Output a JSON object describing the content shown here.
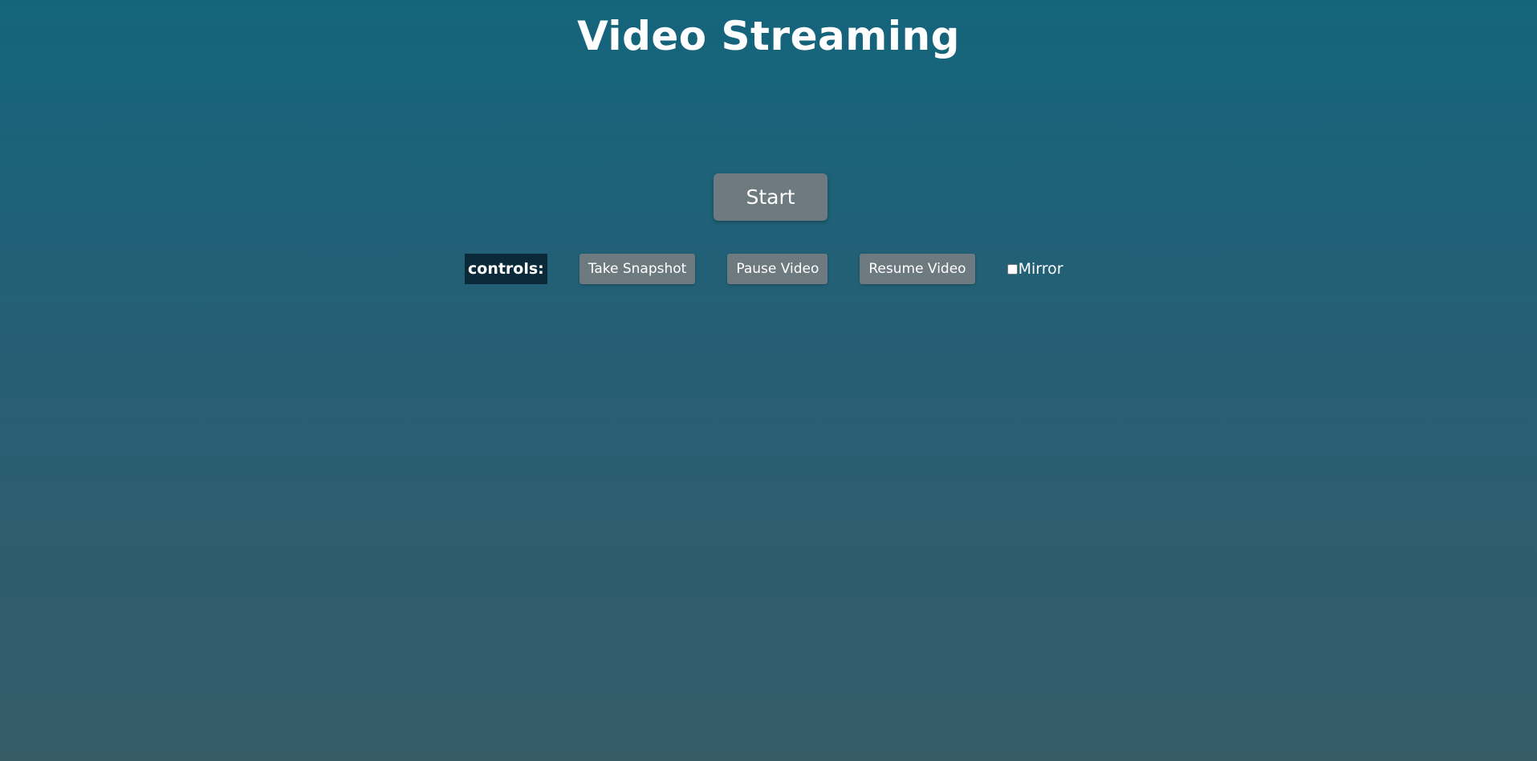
{
  "page": {
    "title": "Video Streaming"
  },
  "start_button": {
    "label": "Start"
  },
  "controls": {
    "label": "controls:",
    "snapshot_label": "Take Snapshot",
    "pause_label": "Pause Video",
    "resume_label": "Resume Video",
    "mirror_label": "Mirror",
    "mirror_checked": false
  },
  "colors": {
    "background_top": "#14657c",
    "background_bottom": "#355b67",
    "button_bg": "#6d7a80",
    "controls_label_bg": "#0a2a3a"
  }
}
